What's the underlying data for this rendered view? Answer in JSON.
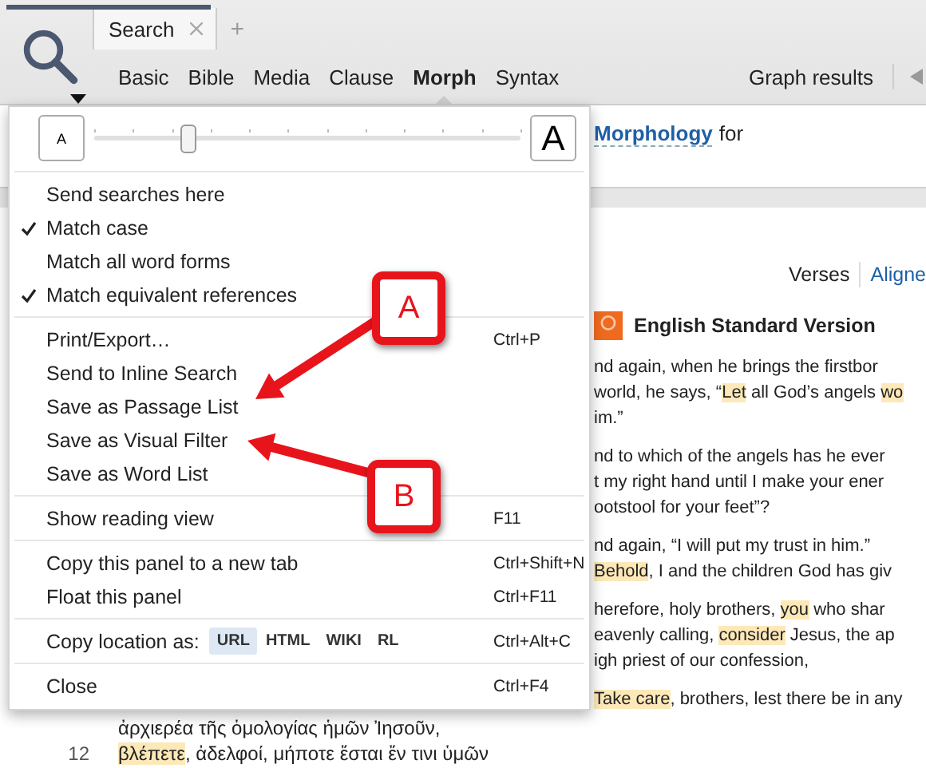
{
  "tabs": [
    {
      "label": "Search",
      "selected": true,
      "closable": true
    }
  ],
  "new_tab": "+",
  "nav": [
    {
      "label": "Basic",
      "selected": false
    },
    {
      "label": "Bible",
      "selected": false
    },
    {
      "label": "Media",
      "selected": false
    },
    {
      "label": "Clause",
      "selected": false
    },
    {
      "label": "Morph",
      "selected": true
    },
    {
      "label": "Syntax",
      "selected": false
    }
  ],
  "graph_results": "Graph results",
  "query": {
    "link": "Morphology",
    "text": "for"
  },
  "view_toggle": [
    {
      "label": "Verses",
      "selected": true
    },
    {
      "label": "Aligne",
      "selected": false
    }
  ],
  "version": {
    "title": "English Standard Version"
  },
  "verses": [
    [
      [
        {
          "t": "nd again, when he brings the firstbor"
        }
      ],
      [
        {
          "t": "world, he says, “"
        },
        {
          "t": "Let",
          "hl": true
        },
        {
          "t": " all God’s angels "
        },
        {
          "t": "wo",
          "hl": true
        }
      ],
      [
        {
          "t": "im.”"
        }
      ]
    ],
    [
      [
        {
          "t": "nd to which of the angels has he ever"
        }
      ],
      [
        {
          "t": "t my right hand until I make your ener"
        }
      ],
      [
        {
          "t": "ootstool for your feet”?"
        }
      ]
    ],
    [
      [
        {
          "t": "nd again, “I will put my trust in him.”"
        }
      ],
      [
        {
          "t": "Behold",
          "hl": true
        },
        {
          "t": ", I and the children God has giv"
        }
      ]
    ],
    [
      [
        {
          "t": "herefore, holy brothers, "
        },
        {
          "t": "you",
          "hl": true
        },
        {
          "t": " who shar"
        }
      ],
      [
        {
          "t": "eavenly calling, "
        },
        {
          "t": "consider",
          "hl": true
        },
        {
          "t": " Jesus, the ap"
        }
      ],
      [
        {
          "t": "igh priest of our confession,"
        }
      ]
    ],
    [
      [
        {
          "t": "Take care",
          "hl": true
        },
        {
          "t": ", brothers, lest there be in any"
        }
      ]
    ]
  ],
  "greek": [
    {
      "segments": [
        {
          "t": "ἀρχιερέα τῆς ὁμολογίας ἡμῶν Ἰησοῦν,"
        }
      ]
    },
    {
      "number": "12",
      "segments": [
        {
          "t": "βλέπετε",
          "hl": true
        },
        {
          "t": ", ἀδελφοί, μήποτε ἔσται ἔν τινι ὑμῶν"
        }
      ]
    }
  ],
  "menu": {
    "font_slider": {
      "small": "A",
      "large": "A",
      "level": 0.22
    },
    "items": [
      {
        "kind": "separator"
      },
      {
        "kind": "item",
        "label": "Send searches here",
        "checked": false
      },
      {
        "kind": "item",
        "label": "Match case",
        "checked": true
      },
      {
        "kind": "item",
        "label": "Match all word forms",
        "checked": false
      },
      {
        "kind": "item",
        "label": "Match equivalent references",
        "checked": true
      },
      {
        "kind": "separator"
      },
      {
        "kind": "item",
        "label": "Print/Export…",
        "shortcut": "Ctrl+P"
      },
      {
        "kind": "item",
        "label": "Send to Inline Search"
      },
      {
        "kind": "item",
        "label": "Save as Passage List"
      },
      {
        "kind": "item",
        "label": "Save as Visual Filter"
      },
      {
        "kind": "item",
        "label": "Save as Word List"
      },
      {
        "kind": "separator"
      },
      {
        "kind": "item",
        "label": "Show reading view",
        "shortcut": "F11"
      },
      {
        "kind": "separator"
      },
      {
        "kind": "item",
        "label": "Copy this panel to a new tab",
        "shortcut": "Ctrl+Shift+N"
      },
      {
        "kind": "item",
        "label": "Float this panel",
        "shortcut": "Ctrl+F11"
      },
      {
        "kind": "separator"
      },
      {
        "kind": "copy",
        "label": "Copy location as:",
        "shortcut": "Ctrl+Alt+C",
        "formats": [
          {
            "label": "URL",
            "selected": true
          },
          {
            "label": "HTML",
            "selected": false
          },
          {
            "label": "WIKI",
            "selected": false
          },
          {
            "label": "RL",
            "selected": false
          }
        ]
      },
      {
        "kind": "separator"
      },
      {
        "kind": "item",
        "label": "Close",
        "shortcut": "Ctrl+F4"
      }
    ]
  },
  "callouts": [
    {
      "label": "A"
    },
    {
      "label": "B"
    }
  ]
}
